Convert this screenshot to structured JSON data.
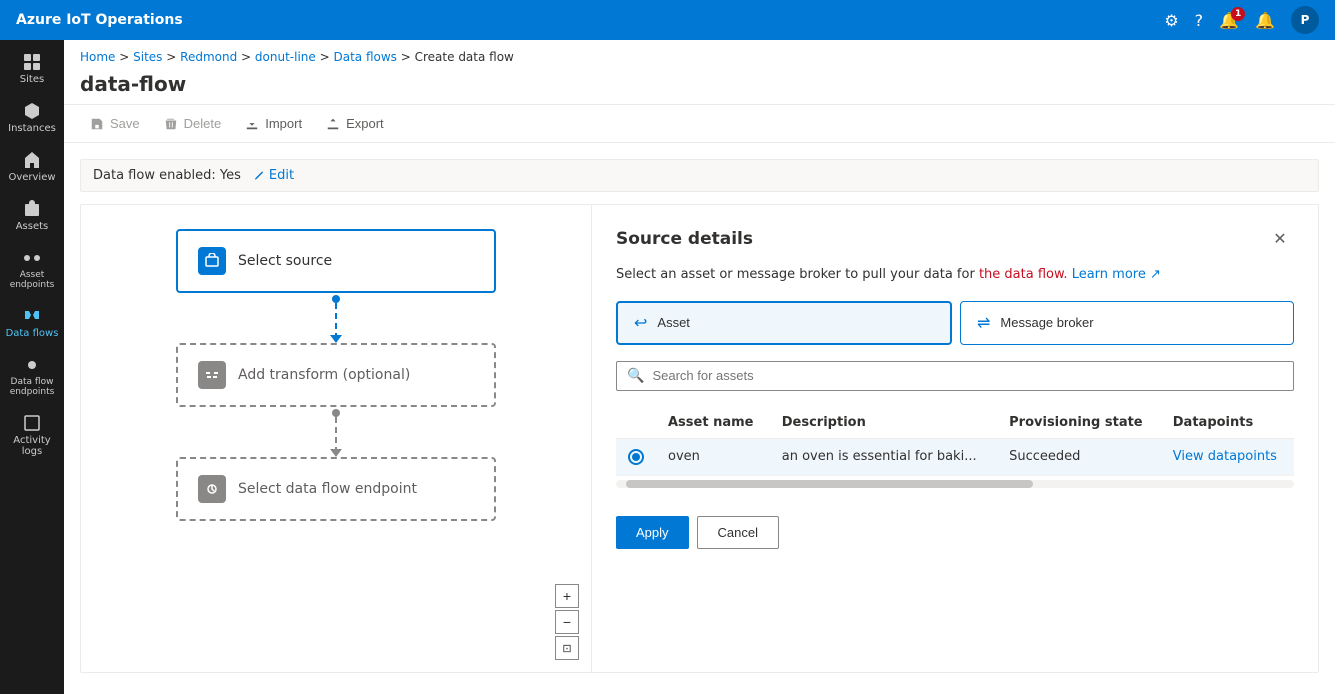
{
  "app": {
    "title": "Azure IoT Operations"
  },
  "topnav": {
    "title": "Azure IoT Operations",
    "notification_count": "1",
    "avatar_label": "P"
  },
  "sidebar": {
    "items": [
      {
        "id": "sites",
        "label": "Sites",
        "icon": "grid"
      },
      {
        "id": "instances",
        "label": "Instances",
        "icon": "cube"
      },
      {
        "id": "overview",
        "label": "Overview",
        "icon": "home"
      },
      {
        "id": "assets",
        "label": "Assets",
        "icon": "box"
      },
      {
        "id": "asset-endpoints",
        "label": "Asset endpoints",
        "icon": "link"
      },
      {
        "id": "data-flows",
        "label": "Data flows",
        "icon": "flow",
        "active": true
      },
      {
        "id": "data-flow-endpoints",
        "label": "Data flow endpoints",
        "icon": "endpoint"
      },
      {
        "id": "activity-logs",
        "label": "Activity logs",
        "icon": "log"
      }
    ]
  },
  "breadcrumb": {
    "items": [
      "Home",
      "Sites",
      "Redmond",
      "donut-line",
      "Data flows",
      "Create data flow"
    ]
  },
  "page": {
    "title": "data-flow"
  },
  "toolbar": {
    "save_label": "Save",
    "delete_label": "Delete",
    "import_label": "Import",
    "export_label": "Export"
  },
  "flow_info": {
    "status_text": "Data flow enabled: Yes",
    "edit_label": "Edit"
  },
  "canvas": {
    "nodes": [
      {
        "id": "source",
        "label": "Select source",
        "type": "solid"
      },
      {
        "id": "transform",
        "label": "Add transform (optional)",
        "type": "dashed"
      },
      {
        "id": "endpoint",
        "label": "Select data flow endpoint",
        "type": "dashed"
      }
    ],
    "controls": [
      "+",
      "−",
      "⊡"
    ]
  },
  "panel": {
    "title": "Source details",
    "description": "Select an asset or message broker to pull your data for",
    "description_highlight": "the data flow.",
    "learn_more": "Learn more",
    "source_types": [
      {
        "id": "asset",
        "label": "Asset",
        "active": true
      },
      {
        "id": "message-broker",
        "label": "Message broker",
        "active": false
      }
    ],
    "search": {
      "placeholder": "Search for assets"
    },
    "table": {
      "columns": [
        "Asset name",
        "Description",
        "Provisioning state",
        "Datapoints"
      ],
      "rows": [
        {
          "asset_name": "oven",
          "description": "an oven is essential for baki...",
          "provisioning_state": "Succeeded",
          "datapoints_label": "View datapoints",
          "selected": true
        }
      ]
    },
    "apply_label": "Apply",
    "cancel_label": "Cancel"
  }
}
